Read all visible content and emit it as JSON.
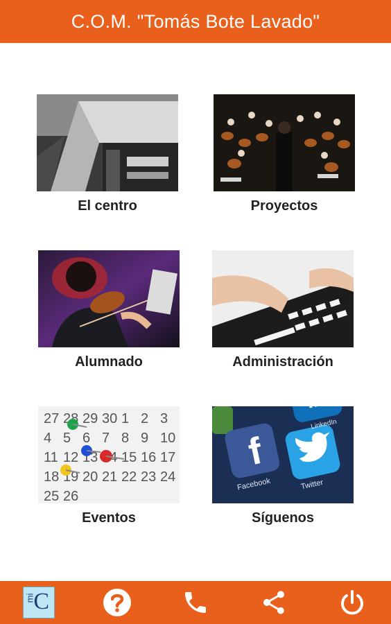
{
  "header": {
    "title": "C.O.M. \"Tomás Bote Lavado\""
  },
  "tiles": [
    {
      "label": "El centro",
      "image": "building-photo"
    },
    {
      "label": "Proyectos",
      "image": "orchestra-photo"
    },
    {
      "label": "Alumnado",
      "image": "violinist-photo"
    },
    {
      "label": "Administración",
      "image": "keyboard-photo"
    },
    {
      "label": "Eventos",
      "image": "calendar-photo"
    },
    {
      "label": "Síguenos",
      "image": "social-apps-photo"
    }
  ],
  "calendar": {
    "days": [
      "27",
      "28",
      "29",
      "30",
      "1",
      "2",
      "3",
      "4",
      "5",
      "6",
      "7",
      "8",
      "9",
      "10",
      "11",
      "12",
      "13",
      "14",
      "15",
      "16",
      "17",
      "18",
      "19",
      "20",
      "21",
      "22",
      "23",
      "24",
      "25",
      "26"
    ]
  },
  "social": {
    "facebook": "Facebook",
    "twitter": "Twitter",
    "linkedin": "LinkedIn"
  },
  "logo": {
    "mi": "mi",
    "c": "C"
  },
  "bottom_nav": [
    {
      "icon": "app-logo-icon"
    },
    {
      "icon": "help-icon"
    },
    {
      "icon": "phone-icon"
    },
    {
      "icon": "share-icon"
    },
    {
      "icon": "power-icon"
    }
  ],
  "colors": {
    "accent": "#e8601c"
  }
}
